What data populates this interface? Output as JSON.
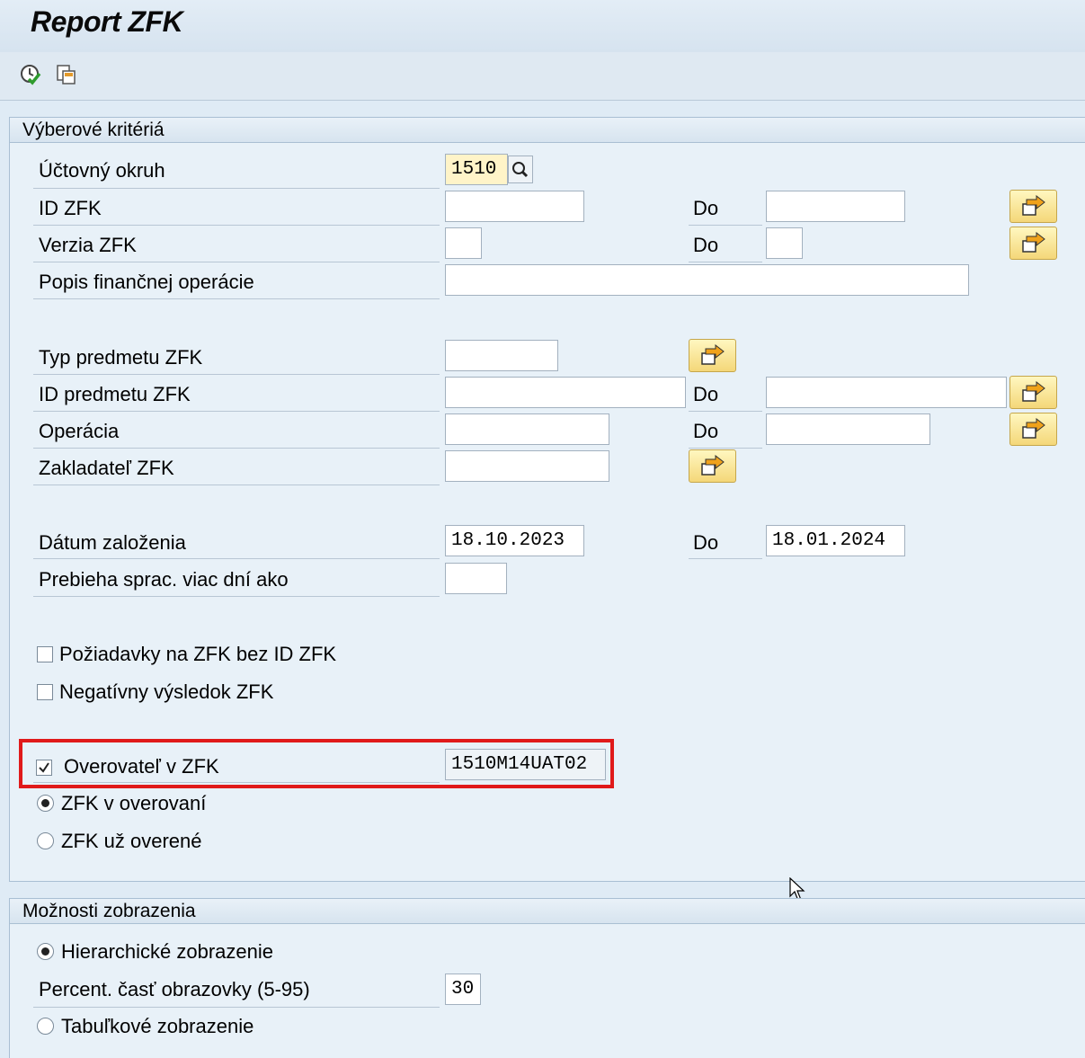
{
  "header": {
    "title": "Report ZFK"
  },
  "toolbar": {
    "icons": [
      "execute-icon",
      "copy-variant-icon"
    ]
  },
  "selection": {
    "title": "Výberové kritériá",
    "accounting_area_label": "Účtovný okruh",
    "accounting_area_value": "1510",
    "zfk_id_label": "ID ZFK",
    "zfk_version_label": "Verzia ZFK",
    "description_label": "Popis finančnej operácie",
    "subject_type_label": "Typ predmetu ZFK",
    "subject_id_label": "ID predmetu ZFK",
    "operation_label": "Operácia",
    "creator_label": "Zakladateľ ZFK",
    "created_date_label": "Dátum založenia",
    "created_from": "18.10.2023",
    "created_to": "18.01.2024",
    "processing_days_label": "Prebieha sprac. viac dní ako",
    "to_label": "Do",
    "requests_without_id_label": "Požiadavky na ZFK bez ID ZFK",
    "negative_result_label": "Negatívny výsledok ZFK",
    "verifier_label": "Overovateľ v ZFK",
    "verifier_value": "1510M14UAT02",
    "verifier_checked": true,
    "in_verification_label": "ZFK v overovaní",
    "already_verified_label": "ZFK už overené"
  },
  "display": {
    "title": "Možnosti zobrazenia",
    "hierarchical_label": "Hierarchické zobrazenie",
    "percent_label": "Percent. časť obrazovky (5-95)",
    "percent_value": "30",
    "table_label": "Tabuľkové zobrazenie"
  },
  "colors": {
    "highlight": "#e01a1a",
    "select_button": "#f4d779"
  }
}
